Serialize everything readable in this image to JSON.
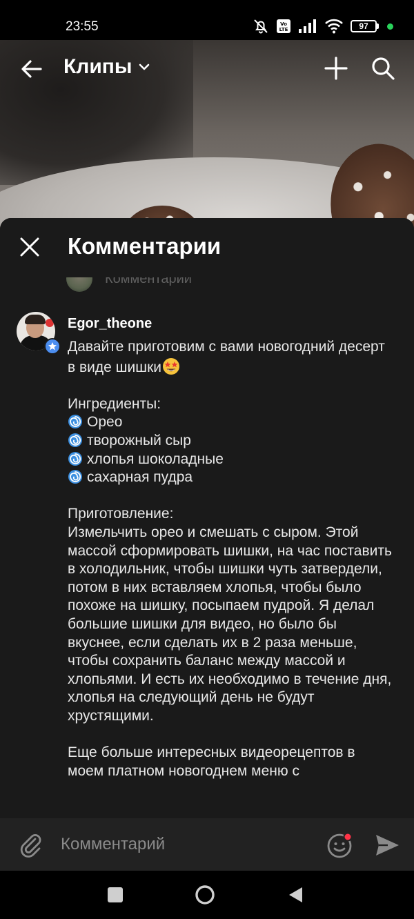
{
  "status_bar": {
    "time": "23:55",
    "battery": "97",
    "icons": [
      "bell-muted-icon",
      "volte-icon",
      "signal-icon",
      "wifi-icon",
      "battery-icon"
    ]
  },
  "top_bar": {
    "title": "Клипы",
    "icons": [
      "arrow-back-icon",
      "chevron-down-icon",
      "plus-icon",
      "search-icon"
    ]
  },
  "sheet": {
    "title": "Комментарии",
    "ghost_label": "Комментарии"
  },
  "comment": {
    "author": "Egor_theone",
    "intro": "Давайте приготовим с вами новогодний десерт в виде шишки",
    "ingredients_title": "Ингредиенты:",
    "ingredients": [
      "Орео",
      "творожный сыр",
      "хлопья шоколадные",
      "сахарная пудра"
    ],
    "prep_title": "Приготовление:",
    "prep_text": "Измельчить орео и смешать с сыром. Этой массой сформировать шишки, на час поставить в холодильник, чтобы шишки чуть затвердели, потом в них вставляем хлопья, чтобы было похоже на шишку, посыпаем пудрой. Я делал большие шишки для видео, но было бы вкуснее, если сделать их в 2 раза меньше, чтобы сохранить баланс между массой и хлопьями. И есть их необходимо в течение дня, хлопья на следующий день не будут хрустящими.",
    "outro": "Еще больше интересных видеорецептов в моем платном новогоднем меню с"
  },
  "input_bar": {
    "placeholder": "Комментарий"
  },
  "colors": {
    "sheet_bg": "#1a1a1a",
    "input_bg": "#222222",
    "verified_badge": "#4c8ef0",
    "notification_dot": "#ff3347",
    "battery_dot": "#29d25b"
  }
}
